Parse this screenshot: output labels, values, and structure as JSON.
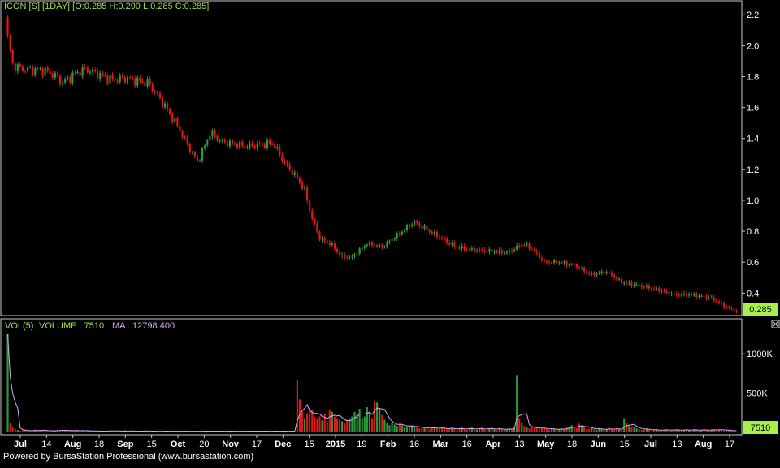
{
  "header": {
    "title": "ICON [S] [1DAY] [O:0.285 H:0.290 L:0.285 C:0.285]",
    "last_price_label": "0.285"
  },
  "volume_header": {
    "vol_label": "VOL(5)",
    "volume_label": "VOLUME : 7510",
    "ma_label": "MA : 12798.400",
    "last_volume_label": "7510"
  },
  "footer": {
    "powered_by": "Powered by BursaStation Professional (www.bursastation.com)"
  },
  "colors": {
    "background": "#000000",
    "up": "#2e9a3a",
    "down": "#e01818",
    "ma_line": "#d6a8f0",
    "title": "#9be04b",
    "axis_text": "#ffffff",
    "price_box": "#a6f04a",
    "frame": "#c8c8c8"
  },
  "chart_data": [
    {
      "type": "candlestick",
      "title": "ICON [S] [1DAY] [O:0.285 H:0.290 L:0.285 C:0.285]",
      "ylim": [
        0.26,
        2.28
      ],
      "yticks": [
        0.4,
        0.6,
        0.8,
        1.0,
        1.2,
        1.4,
        1.6,
        1.8,
        2.0,
        2.2
      ],
      "ytick_labels": [
        "0.4",
        "0.6",
        "0.8",
        "1.0",
        "1.2",
        "1.4",
        "1.6",
        "1.8",
        "2.0",
        "2.2"
      ],
      "x_labels": [
        "Jul",
        "14",
        "Aug",
        "18",
        "Sep",
        "15",
        "Oct",
        "20",
        "Nov",
        "17",
        "Dec",
        "15",
        "2015",
        "19",
        "Feb",
        "16",
        "Mar",
        "16",
        "Apr",
        "13",
        "May",
        "18",
        "Jun",
        "15",
        "Jul",
        "13",
        "Aug",
        "17"
      ],
      "x_label_bold": [
        "Jul",
        "Aug",
        "Sep",
        "Oct",
        "Nov",
        "Dec",
        "2015",
        "Feb",
        "Mar",
        "Apr",
        "May",
        "Jun",
        "Jul",
        "Aug"
      ],
      "close_anchors": [
        [
          0,
          2.05
        ],
        [
          2,
          1.87
        ],
        [
          6,
          1.85
        ],
        [
          14,
          1.84
        ],
        [
          18,
          1.81
        ],
        [
          21,
          1.76
        ],
        [
          26,
          1.82
        ],
        [
          30,
          1.85
        ],
        [
          34,
          1.82
        ],
        [
          40,
          1.78
        ],
        [
          46,
          1.79
        ],
        [
          50,
          1.77
        ],
        [
          54,
          1.76
        ],
        [
          60,
          1.62
        ],
        [
          66,
          1.46
        ],
        [
          70,
          1.33
        ],
        [
          73,
          1.25
        ],
        [
          78,
          1.44
        ],
        [
          82,
          1.38
        ],
        [
          88,
          1.36
        ],
        [
          92,
          1.35
        ],
        [
          98,
          1.36
        ],
        [
          102,
          1.37
        ],
        [
          106,
          1.25
        ],
        [
          110,
          1.17
        ],
        [
          114,
          1.07
        ],
        [
          117,
          0.88
        ],
        [
          120,
          0.75
        ],
        [
          124,
          0.72
        ],
        [
          128,
          0.64
        ],
        [
          132,
          0.63
        ],
        [
          138,
          0.72
        ],
        [
          144,
          0.7
        ],
        [
          150,
          0.78
        ],
        [
          156,
          0.86
        ],
        [
          160,
          0.82
        ],
        [
          166,
          0.76
        ],
        [
          172,
          0.7
        ],
        [
          178,
          0.68
        ],
        [
          186,
          0.67
        ],
        [
          192,
          0.66
        ],
        [
          198,
          0.72
        ],
        [
          202,
          0.68
        ],
        [
          206,
          0.6
        ],
        [
          212,
          0.6
        ],
        [
          218,
          0.58
        ],
        [
          224,
          0.52
        ],
        [
          230,
          0.54
        ],
        [
          236,
          0.47
        ],
        [
          242,
          0.45
        ],
        [
          250,
          0.42
        ],
        [
          256,
          0.39
        ],
        [
          262,
          0.39
        ],
        [
          270,
          0.37
        ],
        [
          276,
          0.31
        ],
        [
          280,
          0.285
        ]
      ],
      "volume_k": [
        1300,
        120,
        60,
        45,
        30,
        20,
        25,
        30,
        20,
        15,
        20,
        35,
        25,
        30,
        20,
        25,
        20,
        15,
        20,
        25,
        30,
        25,
        30,
        20,
        25,
        20,
        15,
        30,
        25,
        20,
        20,
        15,
        25,
        20,
        15,
        20,
        15,
        10,
        20,
        15,
        20,
        25,
        15,
        20,
        10,
        15,
        20,
        25,
        10,
        15,
        20,
        15,
        10,
        15,
        20,
        25,
        15,
        10,
        10,
        15,
        20,
        10,
        15,
        20,
        10,
        15,
        10,
        20,
        15,
        10,
        15,
        20,
        10,
        15,
        10,
        15,
        20,
        10,
        15,
        20,
        10,
        15,
        20,
        15,
        10,
        15,
        20,
        10,
        15,
        20,
        10,
        15,
        10,
        15,
        20,
        10,
        15,
        20,
        10,
        15,
        20,
        15,
        10,
        15,
        20,
        10,
        15,
        20,
        15,
        10,
        20,
        15,
        10,
        15,
        20,
        10,
        660,
        420,
        260,
        180,
        240,
        300,
        280,
        200,
        180,
        200,
        150,
        230,
        120,
        280,
        260,
        200,
        180,
        160,
        140,
        120,
        150,
        180,
        200,
        260,
        220,
        300,
        180,
        200,
        320,
        260,
        180,
        400,
        380,
        300,
        220,
        160,
        120,
        90,
        120,
        100,
        80,
        110,
        90,
        70,
        60,
        80,
        90,
        70,
        60,
        50,
        60,
        70,
        50,
        40,
        60,
        70,
        50,
        40,
        60,
        50,
        40,
        50,
        60,
        40,
        30,
        50,
        60,
        40,
        30,
        50,
        60,
        40,
        30,
        50,
        60,
        40,
        30,
        50,
        60,
        40,
        30,
        50,
        40,
        30,
        40,
        50,
        40,
        60,
        730,
        180,
        120,
        80,
        60,
        50,
        60,
        70,
        50,
        40,
        50,
        60,
        40,
        30,
        50,
        40,
        30,
        40,
        50,
        40,
        60,
        70,
        90,
        60,
        50,
        110,
        90,
        60,
        40,
        50,
        60,
        40,
        30,
        50,
        40,
        30,
        40,
        60,
        40,
        30,
        50,
        40,
        30,
        180,
        120,
        80,
        70,
        60,
        50,
        40,
        30,
        40,
        50,
        30,
        20,
        30,
        40,
        30,
        20,
        30,
        40,
        30,
        20,
        30,
        40,
        30,
        20,
        30,
        40,
        30,
        20,
        40,
        30,
        20,
        30,
        40,
        30,
        20,
        30,
        40,
        30,
        40,
        30,
        20,
        25,
        30,
        20,
        15,
        8
      ],
      "volume_ylim": [
        0,
        1250
      ],
      "volume_ticks": [
        500,
        1000
      ],
      "volume_tick_labels": [
        "500K",
        "1000K"
      ]
    }
  ]
}
